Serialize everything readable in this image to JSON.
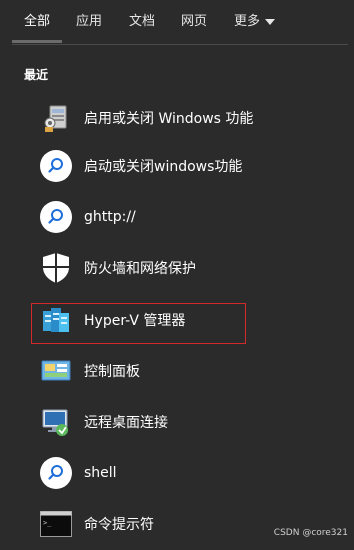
{
  "tabs": [
    {
      "label": "全部"
    },
    {
      "label": "应用"
    },
    {
      "label": "文档"
    },
    {
      "label": "网页"
    },
    {
      "label": "更多"
    }
  ],
  "section": {
    "title": "最近"
  },
  "items": [
    {
      "label": "启用或关闭 Windows 功能",
      "icon": "windows-features-icon"
    },
    {
      "label": "启动或关闭windows功能",
      "icon": "search-icon"
    },
    {
      "label": "ghttp://",
      "icon": "search-icon"
    },
    {
      "label": "防火墙和网络保护",
      "icon": "shield-icon"
    },
    {
      "label": "Hyper-V 管理器",
      "icon": "hyperv-icon"
    },
    {
      "label": "控制面板",
      "icon": "control-panel-icon"
    },
    {
      "label": "远程桌面连接",
      "icon": "remote-desktop-icon"
    },
    {
      "label": "shell",
      "icon": "search-icon"
    },
    {
      "label": "命令提示符",
      "icon": "cmd-icon"
    }
  ],
  "watermark": "CSDN @core321",
  "colors": {
    "background": "#2b2b2b",
    "highlight_border": "#d12a2a",
    "search_icon": "#1e6fd9"
  }
}
